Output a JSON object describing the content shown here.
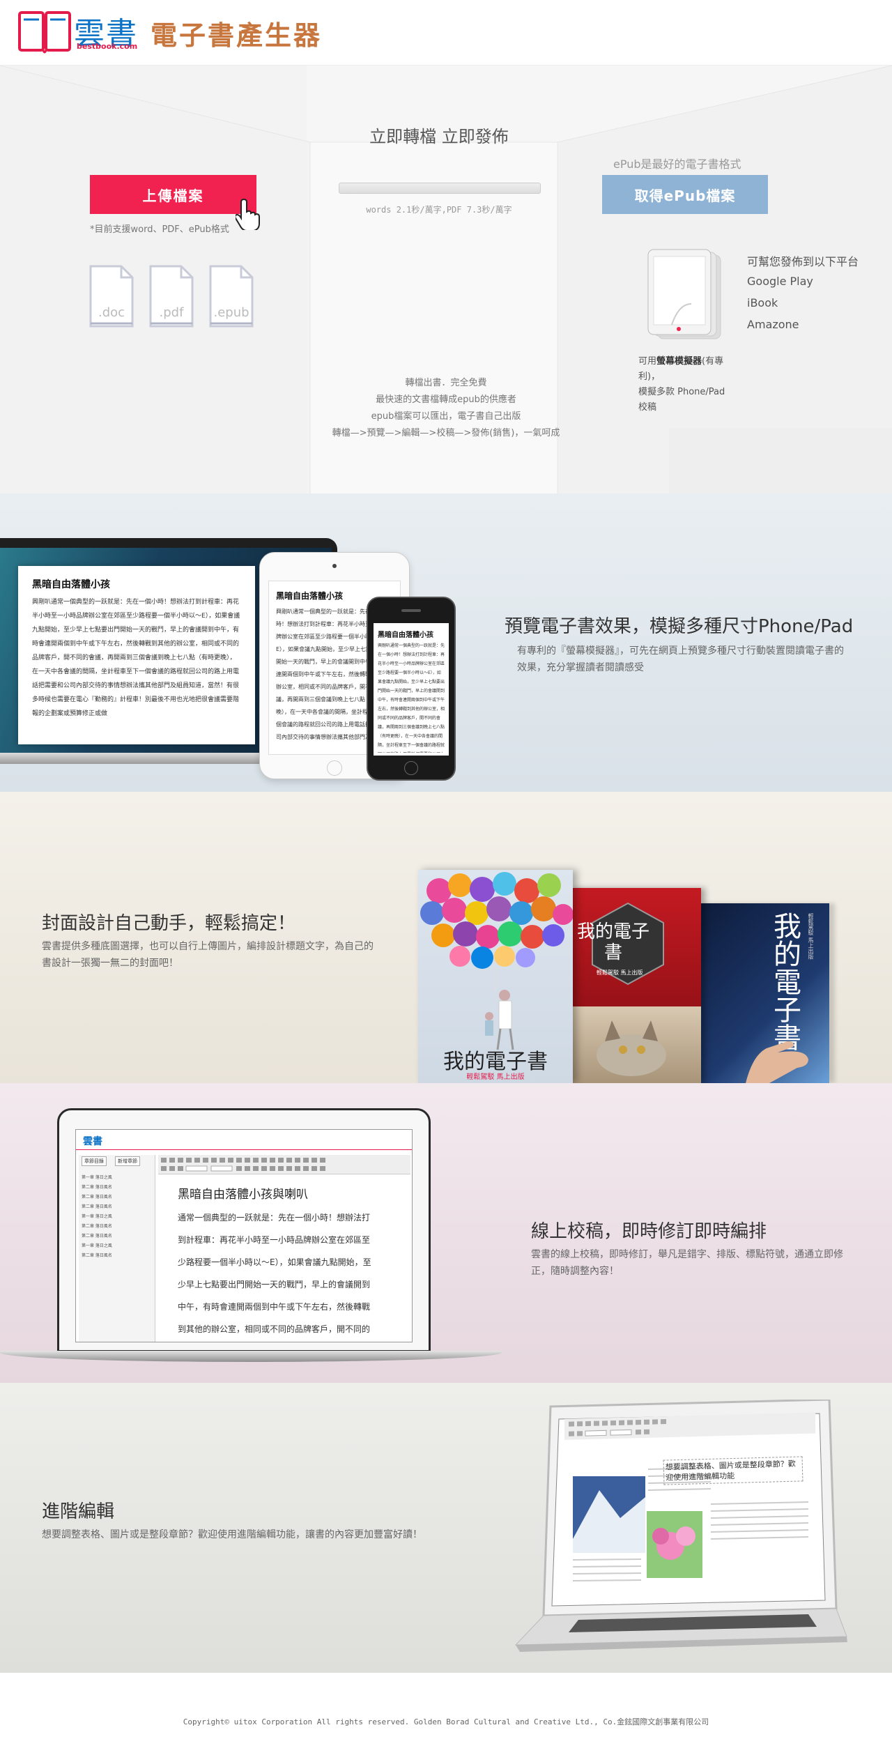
{
  "header": {
    "logo_word": "雲書",
    "logo_url": "bestbook.com",
    "app_title": "電子書產生器"
  },
  "hero": {
    "center_title": "立即轉檔 立即發佈",
    "speed_text": "words 2.1秒/萬字,PDF 7.3秒/萬字",
    "upload_button": "上傳檔案",
    "upload_note": "*目前支援word、PDF、ePub格式",
    "file_types": [
      ".doc",
      ".pdf",
      ".epub"
    ],
    "epub_note": "ePub是最好的電子書格式",
    "get_epub_button": "取得ePub檔案",
    "platform_title": "可幫您發佈到以下平台",
    "platforms": [
      "Google Play",
      "iBook",
      "Amazone"
    ],
    "emulator_prefix": "可用",
    "emulator_name": "螢幕模擬器",
    "emulator_suffix": "(有專利)，",
    "emulator_line2": "模擬多款 Phone/Pad 校稿",
    "lines": [
      "轉檔出書．完全免費",
      "最快速的文書檔轉成epub的供應者",
      "epub檔案可以匯出，電子書自己出版",
      "轉檔—>預覽—>編輯—>校稿—>發佈(銷售)，一氣呵成"
    ]
  },
  "preview": {
    "title": "預覽電子書效果，模擬多種尺寸Phone/Pad",
    "desc": "有專利的『螢幕模擬器』，可先在網頁上預覽多種尺寸行動裝置閱讀電子書的效果，充分掌握讀者閱讀感受",
    "doc_title": "黑暗自由落體小孩",
    "doc_body": "興剛叭通常一個典型的一跃就是：先在一個小時！想辦法打到計程車：再花半小時至一小時品牌辦公室在郊區至少路程要一個半小時以～E），如果會議九點開始，至少早上七點要出門開始一天的戰鬥，早上的會議開到中午，有時會連開兩個到中午或下午左右，然後轉戰到其他的辦公室，相同或不同的品牌客戶，開不同的會議，再開兩到三個會議到晚上七八點（有時更晚），在一天中各會議的間隔，坐計程車至下一個會議的路程就回公司的路上用電話把需要和公司內部交待的事情想辦法攜其他部門及組員知道，當然！有很多時候也需要在電心『勤務的』計程車！別最後不用也光地把很會議需要階報的企劃案或預算修正或做"
  },
  "cover": {
    "title": "封面設計自己動手，輕鬆搞定！",
    "desc": "雲書提供多種底圖選擇，也可以自行上傳圖片，編排設計標題文字，為自己的書設計一張獨一無二的封面吧！",
    "book1_title": "我的電子書",
    "book1_sub": "輕鬆駕駁 馬上出版",
    "book2_title": "我的電子書",
    "book2_sub": "輕鬆駕駁 馬上出版",
    "book3_title": "我的電子書",
    "book3_side": "輕鬆駕駁 馬上出版"
  },
  "proof": {
    "title": "線上校稿，即時修訂即時編排",
    "desc": "雲書的線上校稿，即時修訂，舉凡是錯字、排版、標點符號，通通立即修正，隨時調整內容！",
    "editor_logo": "雲書",
    "toc_buttons": [
      "章節目錄",
      "新增章節"
    ],
    "toc_items": [
      "第一章 落日之風",
      "第二章 落日風名",
      "第二章 落日風名",
      "第二章 落日風名",
      "第一章 落日之風",
      "第二章 落日風名",
      "第二章 落日風名",
      "第一章 落日之風",
      "第二章 落日風名"
    ],
    "doc_title": "黑暗自由落體小孩與喇叭",
    "doc_lines": [
      "通常一個典型的一跃就是：先在一個小時！想辦法打",
      "到計程車：再花半小時至一小時品牌辦公室在郊區至",
      "少路程要一個半小時以～E），如果會議九點開始，至",
      "少早上七點要出門開始一天的戰鬥，早上的會議開到",
      "中午，有時會連開兩個到中午或下午左右，然後轉戰",
      "到其他的辦公室，相同或不同的品牌客戶，開不同的"
    ]
  },
  "advanced": {
    "title": "進階編輯",
    "desc": "想要調整表格、圖片或是整段章節？歡迎使用進階編輯功能，讓書的內容更加豐富好讀！",
    "screen_heading": "想要調整表格、圖片或是整段章節？歡迎使用進階編輯功能"
  },
  "footer": {
    "copyright": "Copyright© uitox Corporation  All rights reserved.  Golden Borad Cultural and Creative Ltd., Co.金鉉國際文創事業有限公司"
  }
}
